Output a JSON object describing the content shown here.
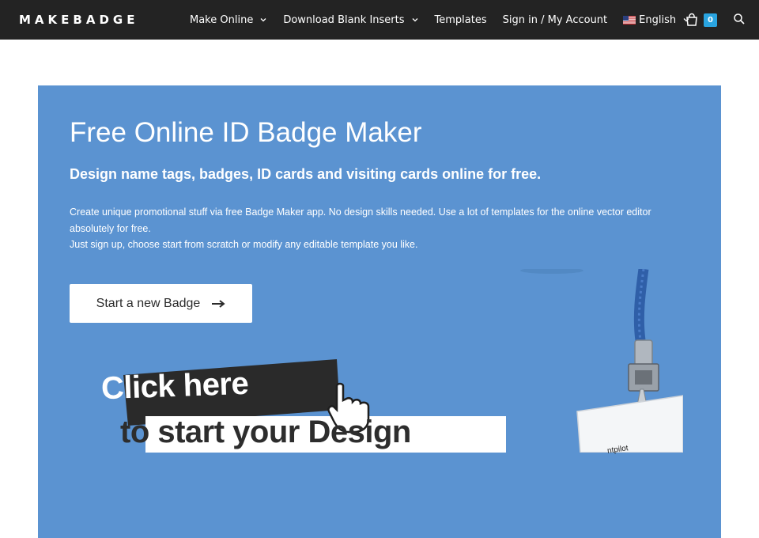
{
  "header": {
    "logo": "MAKEBADGE",
    "nav": [
      {
        "label": "Make Online",
        "has_dropdown": true
      },
      {
        "label": "Download Blank Inserts",
        "has_dropdown": true
      },
      {
        "label": "Templates",
        "has_dropdown": false
      },
      {
        "label": "Sign in / My Account",
        "has_dropdown": false
      },
      {
        "label": "English",
        "has_dropdown": true,
        "icon": "us-flag-icon"
      }
    ],
    "cart_count": "0",
    "cart_icon": "shopping-bag-icon",
    "search_icon": "search-icon"
  },
  "hero": {
    "title": "Free Online ID Badge Maker",
    "subtitle": "Design name tags, badges, ID cards and visiting cards online for free.",
    "description_line1": "Create unique promotional stuff via free Badge Maker app. No design skills needed. Use a lot of templates for the online vector editor absolutely for free.",
    "description_line2": "Just sign up, choose start from scratch or modify any editable template you like.",
    "cta_label": "Start a new Badge",
    "cta_icon": "arrow-right-icon"
  },
  "promo": {
    "line1": "Click here",
    "line2": "to start your Design",
    "badge_text": "ntpilot",
    "icon": "pointer-hand-icon"
  },
  "colors": {
    "topbar": "#232323",
    "hero": "#5b93d1",
    "cart_badge": "#29a4e0"
  }
}
